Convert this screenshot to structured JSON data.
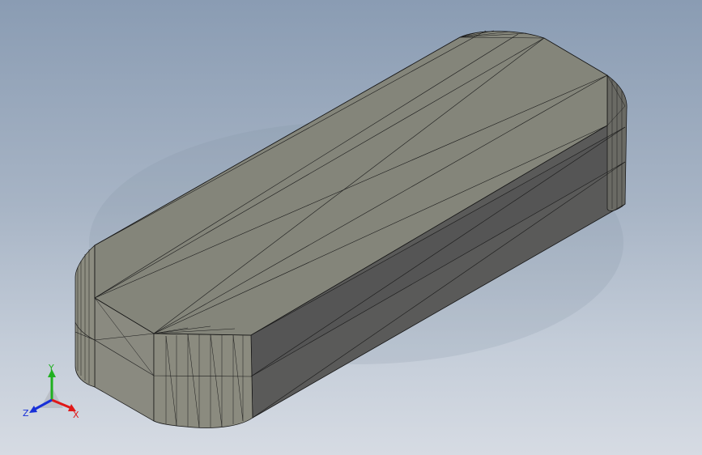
{
  "triad": {
    "x_label": "X",
    "y_label": "Y",
    "z_label": "Z",
    "x_color": "#e01818",
    "y_color": "#20b020",
    "z_color": "#1830d8"
  },
  "model": {
    "top_face_color": "#84857a",
    "side_face_color": "#5a5a59",
    "end_face_color": "#8a8a80",
    "edge_color": "#101010"
  }
}
